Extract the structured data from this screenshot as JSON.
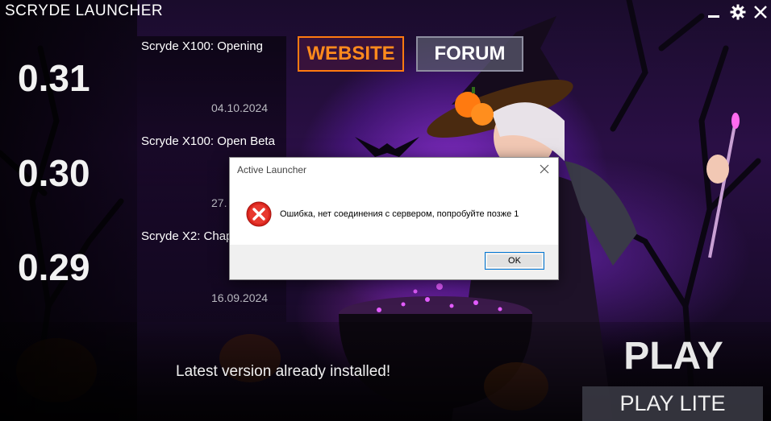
{
  "app": {
    "title": "SCRYDE LAUNCHER"
  },
  "window_controls": {
    "minimize_icon": "minimize-icon",
    "settings_icon": "gear-icon",
    "close_icon": "close-icon"
  },
  "versions": [
    "0.31",
    "0.30",
    "0.29"
  ],
  "news": [
    {
      "title": "Scryde X100: Opening",
      "date": "04.10.2024"
    },
    {
      "title": "Scryde X100: Open Beta",
      "date": "27."
    },
    {
      "title": "Scryde X2: Chap",
      "date": "16.09.2024"
    }
  ],
  "links": {
    "website": "WEBSITE",
    "forum": "FORUM"
  },
  "status": "Latest version already installed!",
  "actions": {
    "play": "PLAY",
    "play_lite": "PLAY LITE"
  },
  "dialog": {
    "title": "Active Launcher",
    "message": "Ошибка, нет соединения с сервером, попробуйте позже 1",
    "ok": "OK",
    "icon": "error-icon"
  },
  "colors": {
    "accent": "#ff7a10",
    "error": "#d9251d",
    "dialog_button_border": "#0078d7"
  }
}
